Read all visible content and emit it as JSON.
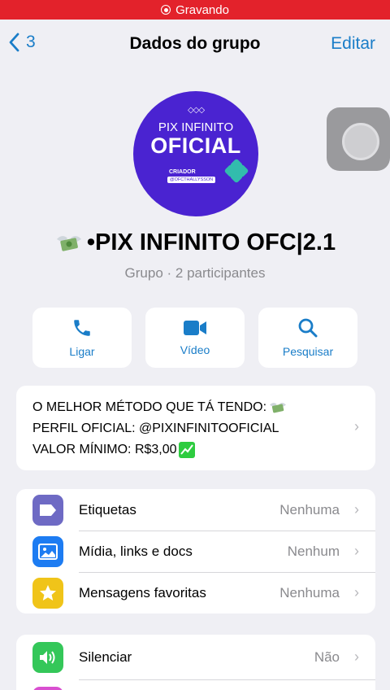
{
  "status_bar": {
    "recording_label": "Gravando"
  },
  "nav": {
    "back_count": "3",
    "title": "Dados do grupo",
    "edit_label": "Editar"
  },
  "avatar": {
    "line1": "PIX INFINITO",
    "line2": "OFICIAL",
    "creator": "CRIADOR",
    "handle": "@OFCTHALLYSSON"
  },
  "group": {
    "name": "•PIX INFINITO OFC|2.1",
    "subtitle": "Grupo · 2 participantes"
  },
  "actions": [
    {
      "label": "Ligar",
      "icon": "phone-icon"
    },
    {
      "label": "Vídeo",
      "icon": "video-icon"
    },
    {
      "label": "Pesquisar",
      "icon": "search-icon"
    }
  ],
  "description": {
    "line1": "O MELHOR MÉTODO QUE TÁ TENDO:",
    "line2": "PERFIL OFICIAL: @PIXINFINITOOFICIAL",
    "line3": "VALOR MÍNIMO: R$3,00"
  },
  "info_rows": [
    {
      "label": "Etiquetas",
      "value": "Nenhuma",
      "icon": "tag-icon",
      "color": "#6e6ac4"
    },
    {
      "label": "Mídia, links e docs",
      "value": "Nenhum",
      "icon": "photo-icon",
      "color": "#1d7cf2"
    },
    {
      "label": "Mensagens favoritas",
      "value": "Nenhuma",
      "icon": "star-icon",
      "color": "#f0c419"
    }
  ],
  "settings_rows": [
    {
      "label": "Silenciar",
      "value": "Não",
      "icon": "speaker-icon",
      "color": "#34c759"
    }
  ],
  "colors": {
    "accent": "#1a7dc8",
    "recording": "#e3222b",
    "background": "#efeff4"
  }
}
